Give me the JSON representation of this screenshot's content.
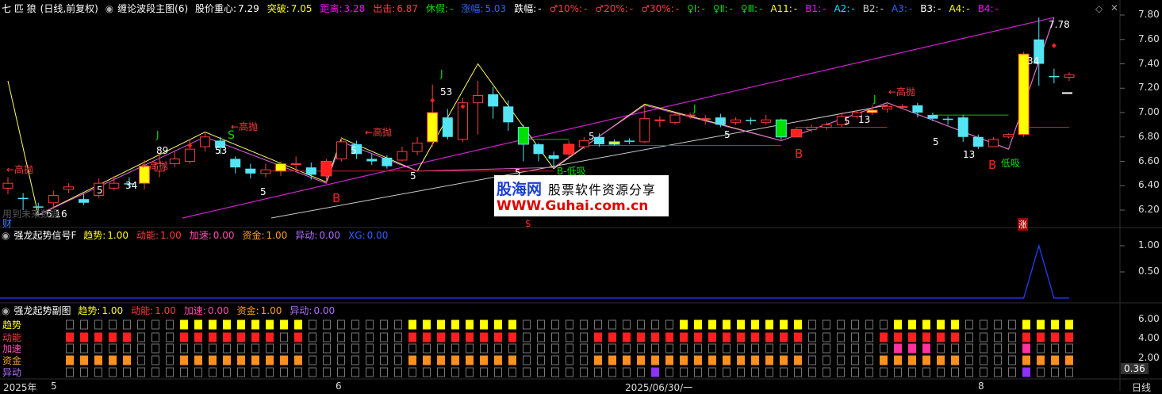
{
  "main_header": {
    "stock_name": "七 匹 狼",
    "period": "(日线,前复权)",
    "indicator_name": "缠论波段主图(6)",
    "items": [
      {
        "label": "股价重心:",
        "value": "7.29",
        "color": "#ffffff"
      },
      {
        "label": "突破:",
        "value": "7.05",
        "color": "#ffff00"
      },
      {
        "label": "距离:",
        "value": "3.28",
        "color": "#ff00ff"
      },
      {
        "label": "出击:",
        "value": "6.87",
        "color": "#ff3b3b"
      },
      {
        "label": "休假:",
        "value": "-",
        "color": "#00e000"
      },
      {
        "label": "涨幅:",
        "value": "5.03",
        "color": "#3060ff"
      },
      {
        "label": "跌幅:",
        "value": "-",
        "color": "#ffffff"
      },
      {
        "label": "♂10%:",
        "value": "-",
        "color": "#ff3b3b"
      },
      {
        "label": "♂20%:",
        "value": "-",
        "color": "#ff3b3b"
      },
      {
        "label": "♂30%:",
        "value": "-",
        "color": "#ff3b3b"
      },
      {
        "label": "♀Ⅰ:",
        "value": "-",
        "color": "#00e000"
      },
      {
        "label": "♀Ⅱ:",
        "value": "-",
        "color": "#00e000"
      },
      {
        "label": "♀Ⅲ:",
        "value": "-",
        "color": "#00e000"
      },
      {
        "label": "A11:",
        "value": "-",
        "color": "#ffff00"
      },
      {
        "label": "B1:",
        "value": "-",
        "color": "#ff00ff"
      },
      {
        "label": "A2:",
        "value": "-",
        "color": "#00e5ff"
      },
      {
        "label": "B2:",
        "value": "-",
        "color": "#cccccc"
      },
      {
        "label": "A3:",
        "value": "-",
        "color": "#3060ff"
      },
      {
        "label": "B3:",
        "value": "-",
        "color": "#ffffff"
      },
      {
        "label": "A4:",
        "value": "-",
        "color": "#ffff00"
      },
      {
        "label": "B4:",
        "value": "-",
        "color": "#ff00ff"
      }
    ]
  },
  "main_axis": {
    "ticks": [
      "7.80",
      "7.60",
      "7.40",
      "7.20",
      "7.00",
      "6.80",
      "6.60",
      "6.40",
      "6.20"
    ]
  },
  "candles": [
    {
      "o": 6.38,
      "c": 6.42,
      "h": 6.47,
      "l": 6.33
    },
    {
      "o": 6.3,
      "c": 6.29,
      "h": 6.34,
      "l": 6.2
    },
    {
      "o": 6.23,
      "c": 6.22,
      "h": 6.26,
      "l": 6.16
    },
    {
      "o": 6.26,
      "c": 6.32,
      "h": 6.36,
      "l": 6.21
    },
    {
      "o": 6.37,
      "c": 6.39,
      "h": 6.42,
      "l": 6.34
    },
    {
      "o": 6.29,
      "c": 6.26,
      "h": 6.33,
      "l": 6.24
    },
    {
      "o": 6.32,
      "c": 6.42,
      "h": 6.46,
      "l": 6.3
    },
    {
      "o": 6.38,
      "c": 6.42,
      "h": 6.48,
      "l": 6.36
    },
    {
      "o": 6.42,
      "c": 6.41,
      "h": 6.47,
      "l": 6.38
    },
    {
      "o": 6.42,
      "c": 6.56,
      "h": 6.61,
      "l": 6.37,
      "fill": "#ffff00"
    },
    {
      "o": 6.52,
      "c": 6.58,
      "h": 6.66,
      "l": 6.47
    },
    {
      "o": 6.58,
      "c": 6.62,
      "h": 6.68,
      "l": 6.55
    },
    {
      "o": 6.6,
      "c": 6.7,
      "h": 6.78,
      "l": 6.58
    },
    {
      "o": 6.72,
      "c": 6.8,
      "h": 6.84,
      "l": 6.68
    },
    {
      "o": 6.77,
      "c": 6.71,
      "h": 6.8,
      "l": 6.66
    },
    {
      "o": 6.62,
      "c": 6.55,
      "h": 6.64,
      "l": 6.5
    },
    {
      "o": 6.54,
      "c": 6.5,
      "h": 6.58,
      "l": 6.46
    },
    {
      "o": 6.5,
      "c": 6.53,
      "h": 6.58,
      "l": 6.47
    },
    {
      "o": 6.52,
      "c": 6.58,
      "h": 6.6,
      "l": 6.48,
      "fill": "#ffff00"
    },
    {
      "o": 6.58,
      "c": 6.58,
      "h": 6.64,
      "l": 6.52
    },
    {
      "o": 6.55,
      "c": 6.49,
      "h": 6.59,
      "l": 6.45
    },
    {
      "o": 6.48,
      "c": 6.6,
      "h": 6.62,
      "l": 6.42,
      "fill": "#ff2020"
    },
    {
      "o": 6.62,
      "c": 6.76,
      "h": 6.8,
      "l": 6.6
    },
    {
      "o": 6.74,
      "c": 6.66,
      "h": 6.77,
      "l": 6.62
    },
    {
      "o": 6.62,
      "c": 6.6,
      "h": 6.66,
      "l": 6.57
    },
    {
      "o": 6.63,
      "c": 6.56,
      "h": 6.65,
      "l": 6.54
    },
    {
      "o": 6.61,
      "c": 6.68,
      "h": 6.72,
      "l": 6.6
    },
    {
      "o": 6.68,
      "c": 6.75,
      "h": 6.8,
      "l": 6.65
    },
    {
      "o": 6.76,
      "c": 7.0,
      "h": 7.23,
      "l": 6.72,
      "fill": "#ffff00"
    },
    {
      "o": 6.96,
      "c": 6.8,
      "h": 7.03,
      "l": 6.78
    },
    {
      "o": 6.78,
      "c": 7.08,
      "h": 7.12,
      "l": 6.76
    },
    {
      "o": 7.08,
      "c": 7.14,
      "h": 7.26,
      "l": 6.82
    },
    {
      "o": 7.15,
      "c": 7.05,
      "h": 7.21,
      "l": 6.95
    },
    {
      "o": 7.05,
      "c": 6.92,
      "h": 7.1,
      "l": 6.85
    },
    {
      "o": 6.88,
      "c": 6.74,
      "h": 6.9,
      "l": 6.6,
      "fill": "#00e000"
    },
    {
      "o": 6.74,
      "c": 6.66,
      "h": 6.75,
      "l": 6.6
    },
    {
      "o": 6.65,
      "c": 6.62,
      "h": 6.68,
      "l": 6.55
    },
    {
      "o": 6.66,
      "c": 6.74,
      "h": 6.77,
      "l": 6.63,
      "fill": "#ff2020"
    },
    {
      "o": 6.72,
      "c": 6.77,
      "h": 6.8,
      "l": 6.7
    },
    {
      "o": 6.8,
      "c": 6.74,
      "h": 6.83,
      "l": 6.72
    },
    {
      "o": 6.76,
      "c": 6.74,
      "h": 6.78,
      "l": 6.73,
      "fill": "#ffff00"
    },
    {
      "o": 6.77,
      "c": 6.76,
      "h": 6.79,
      "l": 6.74
    },
    {
      "o": 6.76,
      "c": 6.95,
      "h": 7.06,
      "l": 6.75
    },
    {
      "o": 6.94,
      "c": 6.94,
      "h": 6.97,
      "l": 6.88
    },
    {
      "o": 6.92,
      "c": 6.98,
      "h": 7.0,
      "l": 6.9
    },
    {
      "o": 6.98,
      "c": 6.98,
      "h": 7.0,
      "l": 6.95
    },
    {
      "o": 6.95,
      "c": 6.95,
      "h": 6.98,
      "l": 6.9
    },
    {
      "o": 6.96,
      "c": 6.9,
      "h": 6.99,
      "l": 6.88
    },
    {
      "o": 6.92,
      "c": 6.94,
      "h": 6.96,
      "l": 6.9
    },
    {
      "o": 6.94,
      "c": 6.93,
      "h": 6.96,
      "l": 6.9
    },
    {
      "o": 6.92,
      "c": 6.94,
      "h": 6.98,
      "l": 6.9
    },
    {
      "o": 6.94,
      "c": 6.8,
      "h": 6.95,
      "l": 6.78,
      "fill": "#00e000"
    },
    {
      "o": 6.8,
      "c": 6.86,
      "h": 6.88,
      "l": 6.8,
      "fill": "#ff2020"
    },
    {
      "o": 6.86,
      "c": 6.88,
      "h": 6.9,
      "l": 6.84
    },
    {
      "o": 6.88,
      "c": 6.9,
      "h": 6.92,
      "l": 6.86
    },
    {
      "o": 6.9,
      "c": 6.97,
      "h": 7.0,
      "l": 6.88
    },
    {
      "o": 6.97,
      "c": 7.0,
      "h": 7.02,
      "l": 6.95
    },
    {
      "o": 7.0,
      "c": 7.02,
      "h": 7.06,
      "l": 6.98,
      "fill": "#ffff00"
    },
    {
      "o": 7.03,
      "c": 7.05,
      "h": 7.07,
      "l": 7.0
    },
    {
      "o": 7.05,
      "c": 7.05,
      "h": 7.07,
      "l": 7.03
    },
    {
      "o": 7.06,
      "c": 7.0,
      "h": 7.08,
      "l": 6.96
    },
    {
      "o": 6.98,
      "c": 6.95,
      "h": 7.0,
      "l": 6.93
    },
    {
      "o": 6.95,
      "c": 6.94,
      "h": 6.97,
      "l": 6.9
    },
    {
      "o": 6.96,
      "c": 6.8,
      "h": 6.98,
      "l": 6.76
    },
    {
      "o": 6.8,
      "c": 6.72,
      "h": 6.82,
      "l": 6.7
    },
    {
      "o": 6.72,
      "c": 6.78,
      "h": 6.8,
      "l": 6.72
    },
    {
      "o": 6.8,
      "c": 6.82,
      "h": 6.83,
      "l": 6.79
    },
    {
      "o": 6.82,
      "c": 7.48,
      "h": 7.5,
      "l": 6.8,
      "fill": "#ffff00"
    },
    {
      "o": 7.6,
      "c": 7.4,
      "h": 7.78,
      "l": 7.22
    },
    {
      "o": 7.3,
      "c": 7.29,
      "h": 7.36,
      "l": 7.24
    },
    {
      "o": 7.29,
      "c": 7.31,
      "h": 7.33,
      "l": 7.26
    }
  ],
  "annotations": {
    "left_sell": "←高抛",
    "sell_1": "←高抛",
    "sell_2": "←高抛",
    "sell_3": "←高抛",
    "sell_4": "←高抛",
    "sell_5": "←高抛",
    "buy_1": "B",
    "buy_2": "B",
    "buy_3": "B",
    "low_buy_1": "B-低吸",
    "low_buy_2": "低吸",
    "s_mark": "S",
    "s_bottom": "$",
    "low_price": "6.16",
    "high_price": "7.78",
    "n89": "89",
    "n53a": "53",
    "n53b": "53",
    "n34": "34",
    "n13a": "13",
    "n13b": "13",
    "n5a": "5",
    "n5b": "5",
    "n5c": "5",
    "n5d": "5",
    "n5e": "5",
    "n5f": "5",
    "n5g": "5",
    "n5h": "5",
    "n5i": "5",
    "n34b": "34",
    "j1": "J",
    "j2": "J",
    "j3": "J",
    "j4": "J",
    "faint_text": "用到未来数据",
    "cai": "财",
    "zhang": "涨"
  },
  "watermark": {
    "title": "股海网",
    "subtitle": "股票软件资源分享",
    "url": "WWW.Guhai.com.cn"
  },
  "signal_panel": {
    "name": "强龙起势信号F",
    "items": [
      {
        "label": "趋势:",
        "value": "1.00",
        "color": "#ffff00"
      },
      {
        "label": "动能:",
        "value": "1.00",
        "color": "#ff3b3b"
      },
      {
        "label": "加速:",
        "value": "0.00",
        "color": "#ff4ab0"
      },
      {
        "label": "资金:",
        "value": "1.00",
        "color": "#ffa020"
      },
      {
        "label": "异动:",
        "value": "0.00",
        "color": "#b070ff"
      },
      {
        "label": "XG:",
        "value": "0.00",
        "color": "#3060ff"
      }
    ],
    "ticks": [
      "1.00",
      "0.50"
    ]
  },
  "sub_panel": {
    "name": "强龙起势副图",
    "items": [
      {
        "label": "趋势:",
        "value": "1.00",
        "color": "#ffff00"
      },
      {
        "label": "动能:",
        "value": "1.00",
        "color": "#ff3b3b"
      },
      {
        "label": "加速:",
        "value": "0.00",
        "color": "#ff4ab0"
      },
      {
        "label": "资金:",
        "value": "1.00",
        "color": "#ffa020"
      },
      {
        "label": "异动:",
        "value": "0.00",
        "color": "#b070ff"
      }
    ],
    "row_labels": [
      {
        "text": "趋势",
        "color": "#ffff00"
      },
      {
        "text": "动能",
        "color": "#ff3b3b"
      },
      {
        "text": "加速",
        "color": "#ff4ab0"
      },
      {
        "text": "资金",
        "color": "#ffa020"
      },
      {
        "text": "异动",
        "color": "#b070ff"
      }
    ],
    "ticks": [
      "6.00",
      "4.00",
      "2.00"
    ],
    "cursor_value": "0.36",
    "columns": [
      [
        0,
        1,
        0,
        1,
        0
      ],
      [
        0,
        1,
        0,
        1,
        0
      ],
      [
        0,
        1,
        0,
        1,
        0
      ],
      [
        0,
        1,
        0,
        1,
        0
      ],
      [
        0,
        1,
        0,
        1,
        0
      ],
      [
        0,
        0,
        0,
        0,
        0
      ],
      [
        0,
        0,
        0,
        0,
        0
      ],
      [
        0,
        0,
        0,
        0,
        0
      ],
      [
        1,
        1,
        0,
        1,
        0
      ],
      [
        1,
        1,
        0,
        1,
        0
      ],
      [
        1,
        1,
        0,
        1,
        0
      ],
      [
        1,
        1,
        0,
        1,
        0
      ],
      [
        1,
        1,
        0,
        1,
        0
      ],
      [
        1,
        1,
        0,
        1,
        0
      ],
      [
        1,
        1,
        0,
        1,
        0
      ],
      [
        1,
        0,
        0,
        1,
        0
      ],
      [
        1,
        1,
        0,
        1,
        0
      ],
      [
        0,
        0,
        0,
        0,
        0
      ],
      [
        0,
        0,
        0,
        0,
        0
      ],
      [
        0,
        0,
        0,
        0,
        0
      ],
      [
        0,
        0,
        0,
        0,
        0
      ],
      [
        0,
        0,
        0,
        0,
        0
      ],
      [
        0,
        0,
        0,
        0,
        0
      ],
      [
        0,
        0,
        0,
        0,
        0
      ],
      [
        1,
        1,
        0,
        1,
        0
      ],
      [
        1,
        1,
        0,
        1,
        0
      ],
      [
        1,
        1,
        0,
        1,
        0
      ],
      [
        1,
        1,
        0,
        1,
        0
      ],
      [
        1,
        1,
        0,
        1,
        0
      ],
      [
        1,
        1,
        0,
        1,
        0
      ],
      [
        1,
        1,
        0,
        1,
        0
      ],
      [
        1,
        1,
        0,
        1,
        0
      ],
      [
        0,
        0,
        0,
        0,
        0
      ],
      [
        0,
        0,
        0,
        0,
        0
      ],
      [
        0,
        0,
        0,
        0,
        0
      ],
      [
        0,
        0,
        0,
        0,
        0
      ],
      [
        0,
        0,
        0,
        0,
        0
      ],
      [
        0,
        1,
        0,
        1,
        0
      ],
      [
        0,
        1,
        0,
        1,
        0
      ],
      [
        0,
        1,
        0,
        1,
        0
      ],
      [
        0,
        1,
        0,
        1,
        0
      ],
      [
        0,
        1,
        0,
        1,
        1
      ],
      [
        0,
        1,
        0,
        1,
        0
      ],
      [
        1,
        1,
        0,
        1,
        0
      ],
      [
        1,
        1,
        0,
        1,
        0
      ],
      [
        1,
        1,
        0,
        1,
        0
      ],
      [
        1,
        1,
        0,
        1,
        0
      ],
      [
        1,
        1,
        0,
        1,
        0
      ],
      [
        1,
        1,
        0,
        1,
        0
      ],
      [
        1,
        1,
        0,
        1,
        0
      ],
      [
        1,
        1,
        0,
        1,
        0
      ],
      [
        1,
        1,
        0,
        1,
        0
      ],
      [
        0,
        0,
        0,
        0,
        0
      ],
      [
        0,
        0,
        0,
        0,
        0
      ],
      [
        0,
        0,
        0,
        0,
        0
      ],
      [
        0,
        0,
        0,
        0,
        0
      ],
      [
        0,
        0,
        0,
        0,
        0
      ],
      [
        0,
        1,
        0,
        1,
        0
      ],
      [
        1,
        1,
        1,
        1,
        0
      ],
      [
        1,
        1,
        1,
        1,
        0
      ],
      [
        1,
        1,
        1,
        1,
        0
      ],
      [
        1,
        1,
        0,
        1,
        0
      ],
      [
        1,
        1,
        0,
        1,
        0
      ],
      [
        0,
        0,
        0,
        0,
        0
      ],
      [
        0,
        0,
        0,
        0,
        0
      ],
      [
        0,
        0,
        0,
        0,
        0
      ],
      [
        0,
        0,
        0,
        0,
        0
      ],
      [
        1,
        1,
        1,
        1,
        1
      ],
      [
        1,
        1,
        0,
        1,
        0
      ],
      [
        1,
        1,
        0,
        1,
        0
      ],
      [
        1,
        1,
        0,
        1,
        0
      ]
    ]
  },
  "x_axis": {
    "labels": [
      "2025年",
      "5",
      "6",
      "2025/06/30/一",
      "8"
    ],
    "period_button": "日线"
  }
}
